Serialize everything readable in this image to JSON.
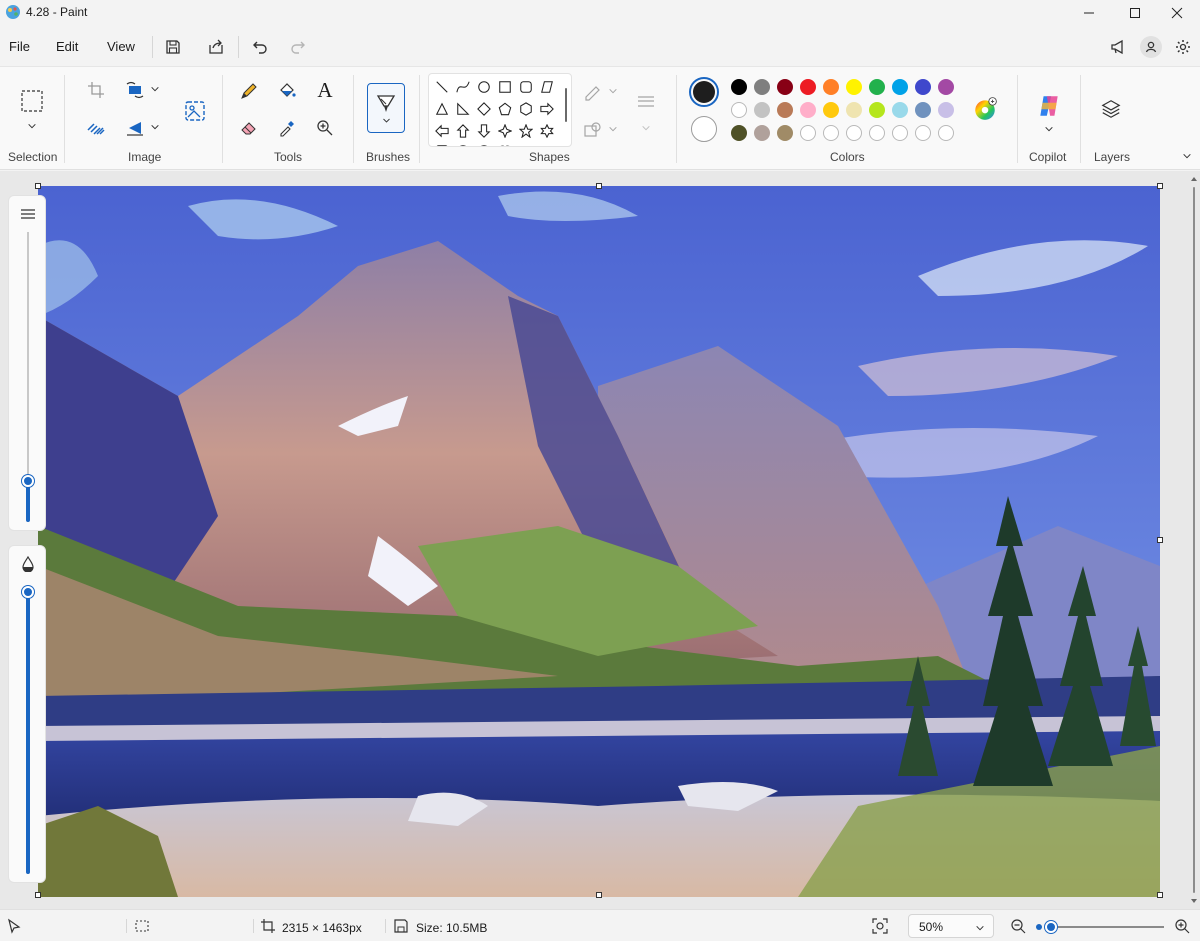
{
  "window": {
    "title": "4.28 - Paint"
  },
  "menu": {
    "file": "File",
    "edit": "Edit",
    "view": "View"
  },
  "ribbon": {
    "groups": {
      "selection": "Selection",
      "image": "Image",
      "tools": "Tools",
      "brushes": "Brushes",
      "shapes": "Shapes",
      "colors": "Colors",
      "copilot": "Copilot",
      "layers": "Layers"
    },
    "text_tool_glyph": "A",
    "shapes": [
      "line",
      "curve",
      "oval",
      "rectangle",
      "rounded-rectangle",
      "polygon",
      "triangle",
      "right-triangle",
      "diamond",
      "pentagon",
      "hexagon",
      "right-arrow",
      "left-arrow",
      "up-arrow",
      "down-arrow",
      "four-point-star",
      "five-point-star",
      "six-point-star",
      "callout-rounded",
      "callout-oval",
      "callout-cloud",
      "heart"
    ],
    "current_colors": {
      "primary": "#1e1e1e",
      "secondary": "#ffffff"
    },
    "palette_row1": [
      "#000000",
      "#7f7f7f",
      "#880015",
      "#ed1c24",
      "#ff7f27",
      "#fff200",
      "#22b14c",
      "#00a2e8",
      "#3f48cc",
      "#a349a4"
    ],
    "palette_row2": [
      "#ffffff",
      "#c3c3c3",
      "#b97a57",
      "#ffaec9",
      "#ffc90e",
      "#efe4b0",
      "#b5e61d",
      "#99d9ea",
      "#7092be",
      "#c8bfe7"
    ],
    "palette_row3": [
      "#4f5127",
      "#b0a19b",
      "#a08b67",
      "",
      "",
      "",
      "",
      "",
      "",
      ""
    ]
  },
  "status": {
    "canvas_size": "2315 × 1463px",
    "file_size": "Size: 10.5MB",
    "zoom": "50%"
  },
  "sliders": {
    "brush_size_fraction": 0.14,
    "opacity_fraction": 1.0,
    "zoom_fraction": 0.03
  }
}
